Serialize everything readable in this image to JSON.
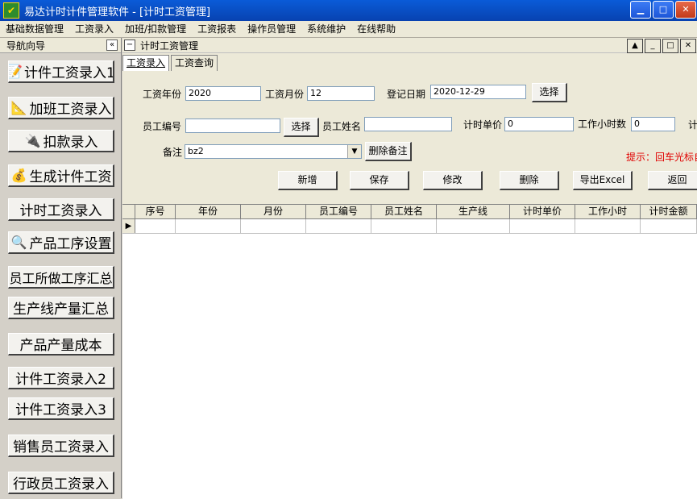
{
  "window": {
    "title": "易达计时计件管理软件    - [计时工资管理]",
    "icon_glyph": "✔",
    "controls": {
      "minimize": "▁",
      "maximize": "□",
      "close": "✕"
    }
  },
  "menu": [
    "基础数据管理",
    "工资录入",
    "加班/扣款管理",
    "工资报表",
    "操作员管理",
    "系统维护",
    "在线帮助"
  ],
  "nav": {
    "header": "导航向导",
    "collapse_glyph": "«",
    "items": [
      {
        "label": "计件工资录入1",
        "icon": "📝"
      },
      {
        "label": "加班工资录入",
        "icon": "📐"
      },
      {
        "label": "扣款录入",
        "icon": "🔌"
      },
      {
        "label": "生成计件工资",
        "icon": "💰"
      },
      {
        "label": "计时工资录入",
        "icon": ""
      },
      {
        "label": "产品工序设置",
        "icon": "🔍"
      },
      {
        "label": "员工所做工序汇总",
        "icon": ""
      },
      {
        "label": "生产线产量汇总",
        "icon": ""
      },
      {
        "label": "产品产量成本",
        "icon": ""
      },
      {
        "label": "计件工资录入2",
        "icon": ""
      },
      {
        "label": "计件工资录入3",
        "icon": ""
      },
      {
        "label": "销售员工资录入",
        "icon": ""
      },
      {
        "label": "行政员工资录入",
        "icon": ""
      }
    ]
  },
  "child": {
    "title": "计时工资管理",
    "icon_glyph": "−",
    "controls": {
      "up": "▲",
      "minimize": "_",
      "maximize": "□",
      "close": "✕"
    },
    "tabs": [
      "工资录入",
      "工资查询"
    ],
    "form": {
      "year_label": "工资年份",
      "year_value": "2020",
      "month_label": "工资月份",
      "month_value": "12",
      "date_label": "登记日期",
      "date_value": "2020-12-29",
      "select_label": "选择",
      "emp_no_label": "员工编号",
      "emp_no_value": "",
      "emp_select_label": "选择",
      "emp_name_label": "员工姓名",
      "emp_name_value": "",
      "unit_price_label": "计时单价",
      "unit_price_value": "0",
      "hours_label": "工作小时数",
      "hours_value": "0",
      "extra_label": "计",
      "remark_label": "备注",
      "remark_value": "bz2",
      "delete_remark_label": "删除备注",
      "hint": "提示：回车光标自"
    },
    "actions": {
      "add": "新增",
      "save": "保存",
      "edit": "修改",
      "delete": "删除",
      "export": "导出Excel",
      "back": "返回"
    },
    "grid": {
      "columns": [
        "序号",
        "年份",
        "月份",
        "员工编号",
        "员工姓名",
        "生产线",
        "计时单价",
        "工作小时",
        "计时金额"
      ],
      "row_indicator": "▶"
    }
  }
}
